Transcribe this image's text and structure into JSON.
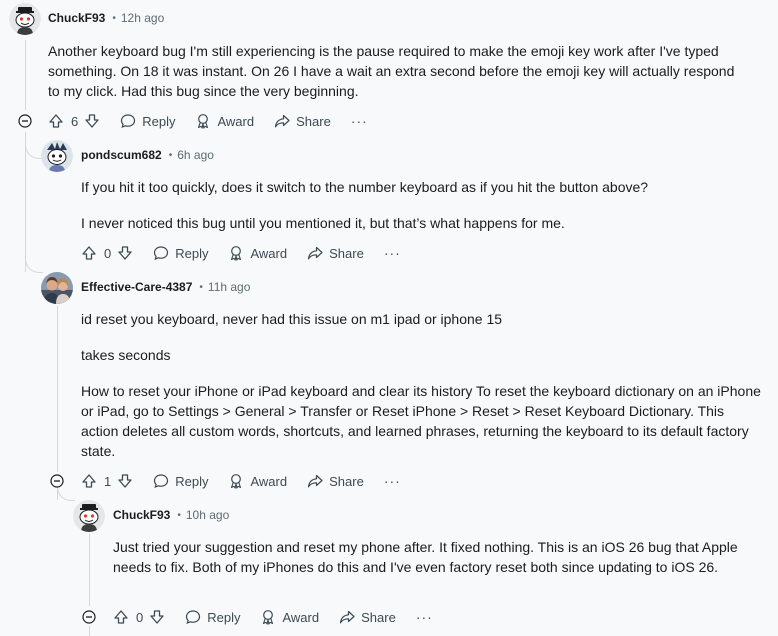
{
  "comments": [
    {
      "username": "ChuckF93",
      "time": "12h ago",
      "paragraphs": [
        "Another keyboard bug I'm still experiencing is the pause required to make the emoji key work after I've typed something. On 18 it was instant. On 26 I have a wait an extra second before the emoji key will actually respond to my click. Had this bug since the very beginning."
      ],
      "votes": "6"
    },
    {
      "username": "pondscum682",
      "time": "6h ago",
      "paragraphs": [
        "If you hit it too quickly, does it switch to the number keyboard as if you hit the button above?",
        "I never noticed this bug until you mentioned it, but that’s what happens for me."
      ],
      "votes": "0"
    },
    {
      "username": "Effective-Care-4387",
      "time": "11h ago",
      "paragraphs": [
        "id reset you keyboard, never had this issue on m1 ipad or iphone 15",
        "takes seconds",
        "How to reset your iPhone or iPad keyboard and clear its history To reset the keyboard dictionary on an iPhone or iPad, go to Settings > General > Transfer or Reset iPhone > Reset > Reset Keyboard Dictionary. This action deletes all custom words, shortcuts, and learned phrases, returning the keyboard to its default factory state."
      ],
      "votes": "1"
    },
    {
      "username": "ChuckF93",
      "time": "10h ago",
      "paragraphs": [
        "Just tried your suggestion and reset my phone after. It fixed nothing. This is an iOS 26 bug that Apple needs to fix. Both of my iPhones do this and I've even factory reset both since updating to iOS 26."
      ],
      "votes": "0"
    }
  ],
  "actions": {
    "reply": "Reply",
    "award": "Award",
    "share": "Share",
    "more": "···",
    "separator": "•"
  },
  "icons": {
    "upvote": "upvote-arrow-icon",
    "downvote": "downvote-arrow-icon",
    "reply": "speech-bubble-icon",
    "award": "award-ribbon-icon",
    "share": "share-arrow-icon",
    "collapse": "collapse-minus-icon"
  },
  "colors": {
    "background": "#f8f9fa",
    "text": "#1a1c1e",
    "muted": "#5c6c74",
    "thread_line": "#d4d7da"
  }
}
